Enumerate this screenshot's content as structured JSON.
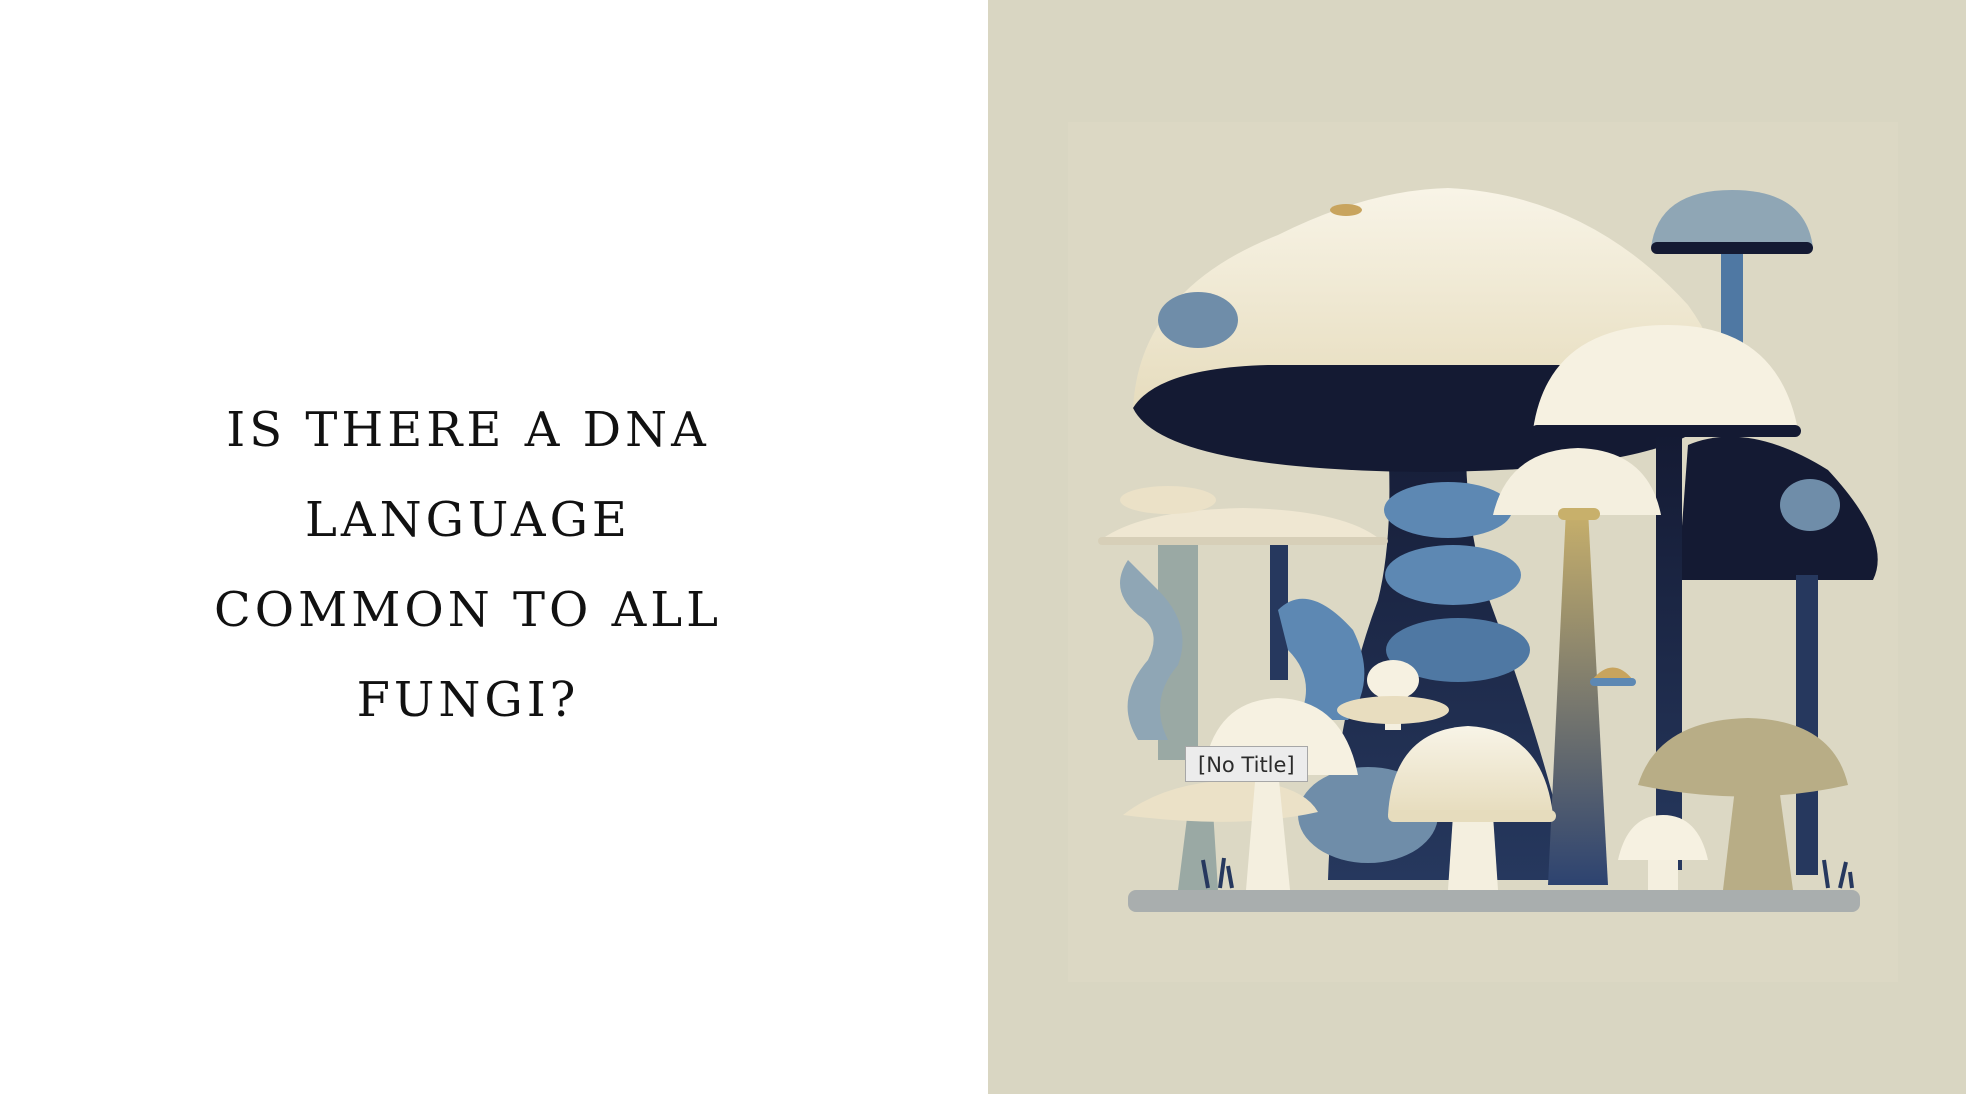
{
  "slide": {
    "title_lines": [
      "IS THERE A DNA",
      "LANGUAGE",
      "COMMON TO ALL",
      "FUNGI?"
    ]
  },
  "image": {
    "subject": "mushroom-illustration"
  },
  "tooltip": {
    "text": "[No Title]"
  },
  "colors": {
    "background_left": "#ffffff",
    "background_right": "#d9d6c2",
    "title_text": "#111111",
    "navy": "#141a33",
    "slate_blue": "#4f78a3",
    "cream": "#f4efdf",
    "khaki": "#b8ad86"
  }
}
